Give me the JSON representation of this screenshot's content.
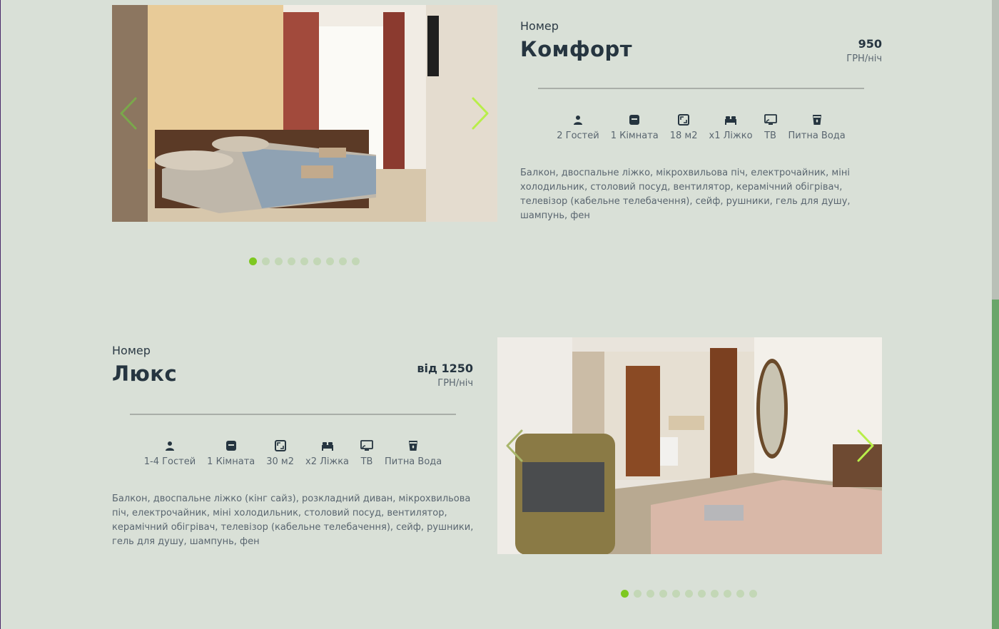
{
  "rooms": [
    {
      "kicker": "Номер",
      "title": "Комфорт",
      "price": "950",
      "price_unit": "ГРН/ніч",
      "amenities": [
        {
          "icon": "person-icon",
          "label": "2 Гостей"
        },
        {
          "icon": "door-icon",
          "label": "1 Кімната"
        },
        {
          "icon": "area-icon",
          "label": "18 м2"
        },
        {
          "icon": "bed-icon",
          "label": "x1 Ліжко"
        },
        {
          "icon": "tv-icon",
          "label": "ТВ"
        },
        {
          "icon": "water-glass-icon",
          "label": "Питна Вода"
        }
      ],
      "description": "Балкон, двоспальне ліжко, мікрохвильова піч, електрочайник, міні холодильник, столовий посуд, вентилятор, керамічний обігрівач, телевізор (кабельне телебачення), сейф, рушники, гель для душу, шампунь, фен",
      "slides": 9,
      "active_slide": 1
    },
    {
      "kicker": "Номер",
      "title": "Люкс",
      "price": "від 1250",
      "price_unit": "ГРН/ніч",
      "amenities": [
        {
          "icon": "person-icon",
          "label": "1-4 Гостей"
        },
        {
          "icon": "door-icon",
          "label": "1 Кімната"
        },
        {
          "icon": "area-icon",
          "label": "30 м2"
        },
        {
          "icon": "bed-icon",
          "label": "x2 Ліжка"
        },
        {
          "icon": "tv-icon",
          "label": "ТВ"
        },
        {
          "icon": "water-glass-icon",
          "label": "Питна Вода"
        }
      ],
      "description": "Балкон, двоспальне ліжко (кінг сайз), розкладний диван, мікрохвильова піч, електрочайник, міні холодильник, столовий посуд, вентилятор, керамічний обігрівач, телевізор (кабельне телебачення), сейф, рушники, гель для душу, шампунь, фен",
      "slides": 11,
      "active_slide": 1
    }
  ],
  "colors": {
    "background": "#d9e0d7",
    "accent": "#7ec820",
    "dot_inactive": "#c3d7b6",
    "text_dark": "#263540",
    "text_muted": "#5a6670"
  }
}
